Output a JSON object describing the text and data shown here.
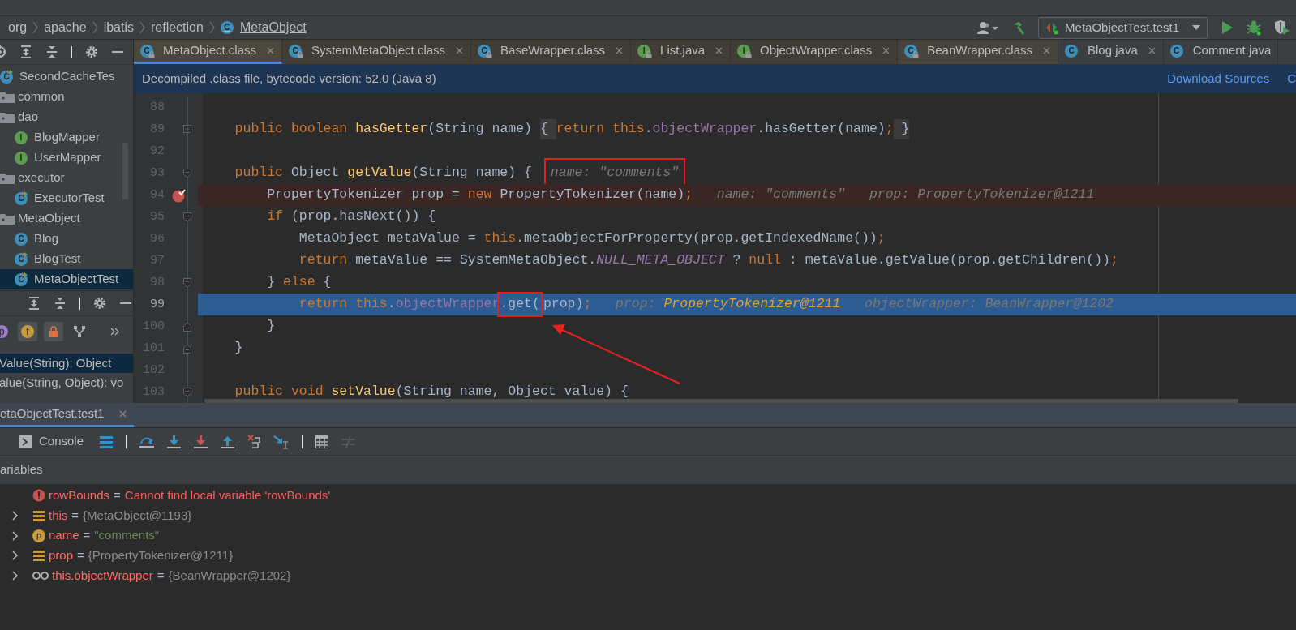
{
  "breadcrumb": [
    {
      "label": "org"
    },
    {
      "label": "apache"
    },
    {
      "label": "ibatis"
    },
    {
      "label": "reflection"
    },
    {
      "label": "MetaObject",
      "icon_letter": "C"
    }
  ],
  "run_toolbar": {
    "run_config": "MetaObjectTest.test1"
  },
  "project_tree": [
    {
      "label": "SecondCacheTes",
      "kind": "test",
      "icon_letter": "C",
      "selected": false
    },
    {
      "label": "common",
      "kind": "folder",
      "selected": false
    },
    {
      "label": "dao",
      "kind": "folder",
      "selected": false,
      "children": [
        {
          "label": "BlogMapper",
          "kind": "interface",
          "icon_letter": "I",
          "selected": false
        },
        {
          "label": "UserMapper",
          "kind": "interface",
          "icon_letter": "I",
          "selected": false
        }
      ]
    },
    {
      "label": "executor",
      "kind": "folder",
      "selected": false,
      "children": [
        {
          "label": "ExecutorTest",
          "kind": "test",
          "icon_letter": "C",
          "selected": false
        }
      ]
    },
    {
      "label": "MetaObject",
      "kind": "folder",
      "selected": false,
      "children": [
        {
          "label": "Blog",
          "kind": "class",
          "icon_letter": "C",
          "selected": false
        },
        {
          "label": "BlogTest",
          "kind": "test",
          "icon_letter": "C",
          "selected": false
        },
        {
          "label": "MetaObjectTest",
          "kind": "test",
          "icon_letter": "C",
          "selected": true
        }
      ]
    }
  ],
  "structure": {
    "filters": [
      {
        "kind": "letter",
        "icon_letter": "p",
        "color": "#9a7cc4",
        "selected": false
      },
      {
        "kind": "letter",
        "icon_letter": "f",
        "color": "#c79a3a",
        "selected": true
      },
      {
        "kind": "lock",
        "selected": true
      },
      {
        "kind": "tree",
        "selected": false
      }
    ],
    "items": [
      {
        "label": "Value(String): Object",
        "selected": true
      },
      {
        "label": "alue(String, Object): vo",
        "selected": false
      }
    ]
  },
  "editor_tabs": [
    {
      "label": "MetaObject.class",
      "kind": "class",
      "icon_letter": "C",
      "locked": true,
      "selected": true,
      "closable": true,
      "color": "#4b473c"
    },
    {
      "label": "SystemMetaObject.class",
      "kind": "class",
      "icon_letter": "C",
      "locked": true,
      "selected": false,
      "closable": true,
      "color": "#403d36"
    },
    {
      "label": "BaseWrapper.class",
      "kind": "class",
      "icon_letter": "C",
      "locked": true,
      "selected": false,
      "closable": true,
      "color": "#403d36"
    },
    {
      "label": "List.java",
      "kind": "interface",
      "icon_letter": "I",
      "locked": true,
      "selected": false,
      "closable": true,
      "color": "#403d36"
    },
    {
      "label": "ObjectWrapper.class",
      "kind": "interface",
      "icon_letter": "I",
      "locked": true,
      "selected": false,
      "closable": true,
      "color": "#403d36"
    },
    {
      "label": "BeanWrapper.class",
      "kind": "class",
      "icon_letter": "C",
      "locked": true,
      "selected": false,
      "closable": true,
      "color": "#47453b"
    },
    {
      "label": "Blog.java",
      "kind": "class",
      "icon_letter": "C",
      "locked": false,
      "selected": false,
      "closable": true,
      "color": "#3c3f41"
    },
    {
      "label": "Comment.java",
      "kind": "class",
      "icon_letter": "C",
      "locked": false,
      "selected": false,
      "closable": false,
      "color": "#3c3f41"
    }
  ],
  "banner": {
    "text": "Decompiled .class file, bytecode version: 52.0 (Java 8)",
    "links": [
      "Download Sources",
      "C"
    ]
  },
  "code_lines": [
    {
      "number": "88",
      "kind": "plain",
      "breakpoint": false,
      "current": false
    },
    {
      "number": "89",
      "kind": "folded",
      "breakpoint": false,
      "current": false,
      "tokens": [
        {
          "text": "    public ",
          "kind": "kw"
        },
        {
          "text": "boolean ",
          "kind": "kw"
        },
        {
          "text": "hasGetter",
          "kind": "fn"
        },
        {
          "text": "(String name) ",
          "kind": "plain"
        },
        {
          "text": "{ ",
          "kind": "fold"
        },
        {
          "text": "return this",
          "kind": "kw"
        },
        {
          "text": ".",
          "kind": "plain"
        },
        {
          "text": "objectWrapper",
          "kind": "field"
        },
        {
          "text": ".hasGetter(name)",
          "kind": "plain"
        },
        {
          "text": ";",
          "kind": "semi"
        },
        {
          "text": " }",
          "kind": "fold"
        }
      ]
    },
    {
      "number": "92",
      "kind": "plain",
      "breakpoint": false,
      "current": false
    },
    {
      "number": "93",
      "kind": "fold-start",
      "breakpoint": false,
      "current": false,
      "tokens": [
        {
          "text": "    public ",
          "kind": "kw"
        },
        {
          "text": "Object ",
          "kind": "plain"
        },
        {
          "text": "getValue",
          "kind": "fn"
        },
        {
          "text": "(String name) {",
          "kind": "plain"
        },
        {
          "text": "name: \"comments\"",
          "kind": "hint",
          "boxed": true
        }
      ]
    },
    {
      "number": "94",
      "kind": "plain",
      "breakpoint": true,
      "current": false,
      "tokens": [
        {
          "text": "        PropertyTokenizer prop = ",
          "kind": "plain"
        },
        {
          "text": "new ",
          "kind": "kw"
        },
        {
          "text": "PropertyTokenizer(name)",
          "kind": "plain"
        },
        {
          "text": ";",
          "kind": "semi"
        },
        {
          "text": "name: \"comments\"",
          "kind": "hint"
        },
        {
          "text": "prop: PropertyTokenizer@1211",
          "kind": "hint"
        }
      ]
    },
    {
      "number": "95",
      "kind": "fold-start",
      "breakpoint": false,
      "current": false,
      "tokens": [
        {
          "text": "        if ",
          "kind": "kw"
        },
        {
          "text": "(prop.hasNext()) {",
          "kind": "plain"
        }
      ]
    },
    {
      "number": "96",
      "kind": "plain",
      "breakpoint": false,
      "current": false,
      "tokens": [
        {
          "text": "            MetaObject metaValue = ",
          "kind": "plain"
        },
        {
          "text": "this",
          "kind": "kw"
        },
        {
          "text": ".metaObjectForProperty(prop.getIndexedName())",
          "kind": "plain"
        },
        {
          "text": ";",
          "kind": "semi"
        }
      ]
    },
    {
      "number": "97",
      "kind": "plain",
      "breakpoint": false,
      "current": false,
      "tokens": [
        {
          "text": "            return ",
          "kind": "kw"
        },
        {
          "text": "metaValue == SystemMetaObject.",
          "kind": "plain"
        },
        {
          "text": "NULL_META_OBJECT",
          "kind": "const"
        },
        {
          "text": " ? ",
          "kind": "plain"
        },
        {
          "text": "null",
          "kind": "kw"
        },
        {
          "text": " : metaValue.getValue(prop.getChildren())",
          "kind": "plain"
        },
        {
          "text": ";",
          "kind": "semi"
        }
      ]
    },
    {
      "number": "98",
      "kind": "fold-start",
      "breakpoint": false,
      "current": false,
      "tokens": [
        {
          "text": "        } ",
          "kind": "plain"
        },
        {
          "text": "else ",
          "kind": "kw"
        },
        {
          "text": "{",
          "kind": "plain"
        }
      ]
    },
    {
      "number": "99",
      "kind": "plain",
      "breakpoint": false,
      "current": true,
      "tokens": [
        {
          "text": "            return this",
          "kind": "kw"
        },
        {
          "text": ".",
          "kind": "plain"
        },
        {
          "text": "objectWrapper",
          "kind": "field"
        },
        {
          "text": ".get(",
          "kind": "plain",
          "boxed": true
        },
        {
          "text": "prop)",
          "kind": "plain"
        },
        {
          "text": ";",
          "kind": "semi"
        },
        {
          "text": "prop:",
          "kind": "hint"
        },
        {
          "text": "PropertyTokenizer@1211",
          "kind": "hintval"
        },
        {
          "text": "objectWrapper: BeanWrapper@1202",
          "kind": "hint"
        }
      ]
    },
    {
      "number": "100",
      "kind": "fold-end",
      "breakpoint": false,
      "current": false,
      "tokens": [
        {
          "text": "        }",
          "kind": "plain"
        }
      ]
    },
    {
      "number": "101",
      "kind": "fold-end",
      "breakpoint": false,
      "current": false,
      "tokens": [
        {
          "text": "    }",
          "kind": "plain"
        }
      ]
    },
    {
      "number": "102",
      "kind": "plain",
      "breakpoint": false,
      "current": false
    },
    {
      "number": "103",
      "kind": "fold-start",
      "breakpoint": false,
      "current": false,
      "tokens": [
        {
          "text": "    public ",
          "kind": "kw"
        },
        {
          "text": "void ",
          "kind": "kw"
        },
        {
          "text": "setValue",
          "kind": "fn"
        },
        {
          "text": "(String name, Object value) {",
          "kind": "plain"
        }
      ]
    }
  ],
  "debug": {
    "tab": {
      "label": "etaObjectTest.test1",
      "selected": true
    },
    "console": "Console",
    "variables_header": "ariables",
    "variables": [
      {
        "kind": "error",
        "expandable": false,
        "name": "rowBounds",
        "operator": "=",
        "value": {
          "text": "Cannot find local variable 'rowBounds'",
          "color": "#ff5a5a"
        }
      },
      {
        "kind": "field",
        "expandable": true,
        "name": "this",
        "operator": "=",
        "value": {
          "text": "{MetaObject@1193}",
          "color": "#8c8c8c"
        }
      },
      {
        "kind": "param",
        "icon_letter": "p",
        "expandable": true,
        "name": "name",
        "operator": "=",
        "value": {
          "text": "\"comments\"",
          "color": "#6a8759"
        }
      },
      {
        "kind": "field",
        "expandable": true,
        "name": "prop",
        "operator": "=",
        "value": {
          "text": "{PropertyTokenizer@1211}",
          "color": "#8c8c8c"
        }
      },
      {
        "kind": "watch",
        "expandable": true,
        "name": "this.objectWrapper",
        "operator": "=",
        "value": {
          "text": "{BeanWrapper@1202}",
          "color": "#8c8c8c"
        }
      }
    ]
  }
}
